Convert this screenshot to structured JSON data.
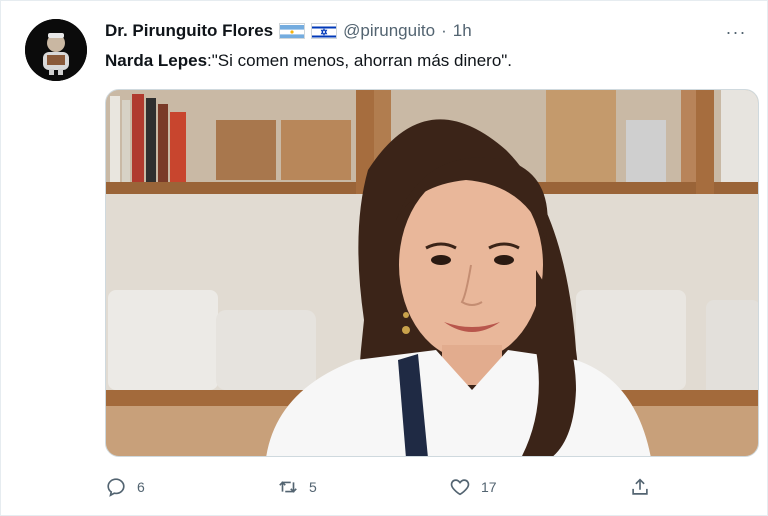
{
  "tweet": {
    "author_name": "Dr. Pirunguito Flores",
    "handle": "@pirunguito",
    "separator": "·",
    "time": "1h",
    "more_label": "···",
    "text_bold": "Narda Lepes",
    "text_rest": ":\"Si comen menos, ahorran más dinero\".",
    "flags": [
      "argentina-flag-icon",
      "israel-flag-icon"
    ]
  },
  "actions": {
    "reply_count": "6",
    "retweet_count": "5",
    "like_count": "17"
  },
  "colors": {
    "secondary_text": "#536471",
    "primary_text": "#0f1419",
    "border": "#cfd9de"
  }
}
